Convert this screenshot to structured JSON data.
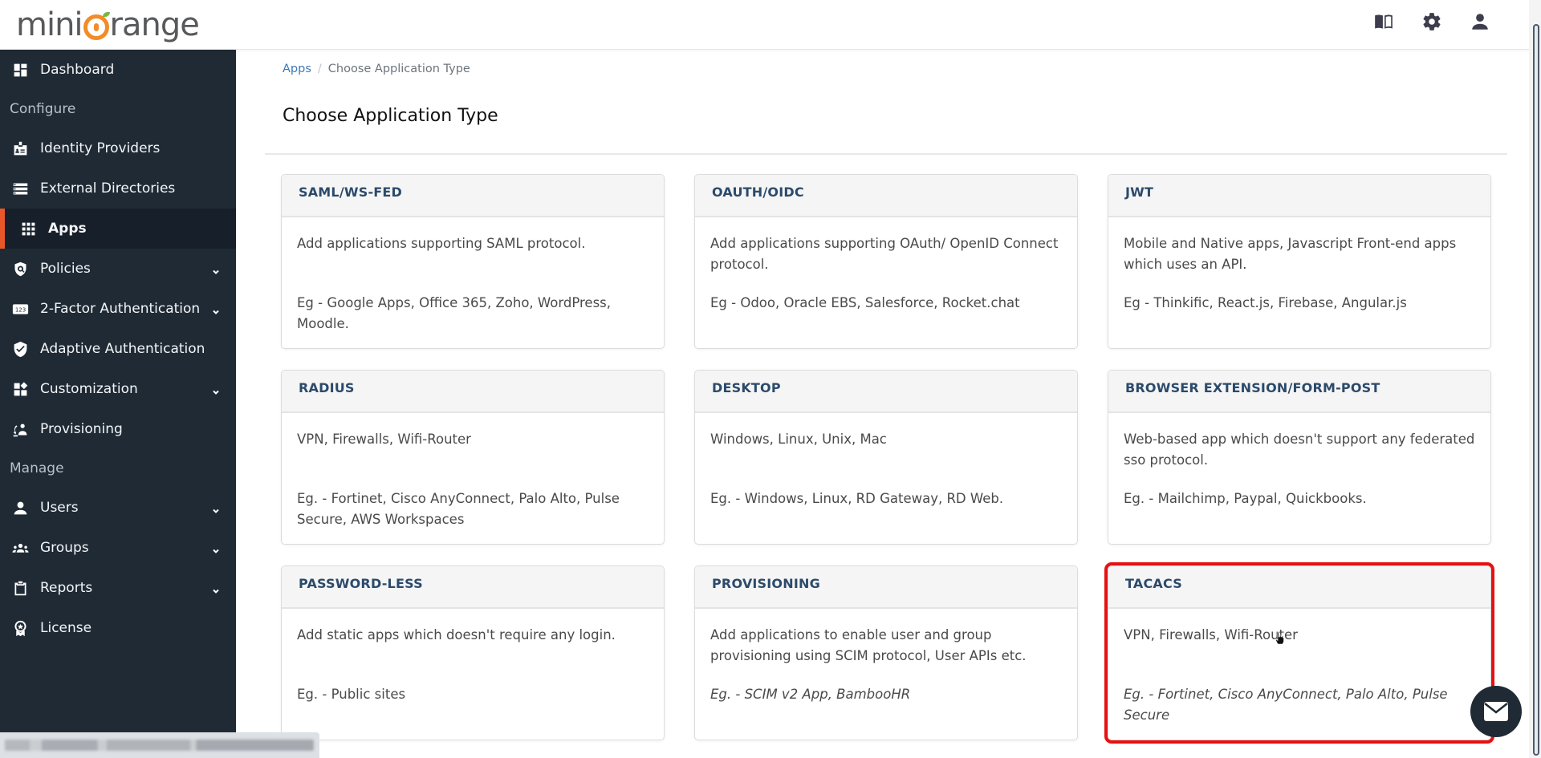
{
  "brand": {
    "name_before": "mini",
    "name_after": "range",
    "accent_orange": "#f28c28",
    "leaf_green": "#7ab648"
  },
  "topbar": {
    "icons": [
      {
        "name": "book-icon",
        "label": "Guides"
      },
      {
        "name": "gear-icon",
        "label": "Settings"
      },
      {
        "name": "user-icon",
        "label": "Account"
      }
    ]
  },
  "sidebar": {
    "items": [
      {
        "type": "item",
        "label": "Dashboard",
        "icon": "dashboard-icon"
      },
      {
        "type": "section",
        "label": "Configure"
      },
      {
        "type": "item",
        "label": "Identity Providers",
        "icon": "id-badge-icon"
      },
      {
        "type": "item",
        "label": "External Directories",
        "icon": "directory-list-icon"
      },
      {
        "type": "item",
        "label": "Apps",
        "icon": "apps-grid-icon",
        "active": true
      },
      {
        "type": "item",
        "label": "Policies",
        "icon": "policy-shield-icon",
        "expandable": true
      },
      {
        "type": "item",
        "label": "2-Factor Authentication",
        "icon": "123-icon",
        "expandable": true
      },
      {
        "type": "item",
        "label": "Adaptive Authentication",
        "icon": "shield-check-icon"
      },
      {
        "type": "item",
        "label": "Customization",
        "icon": "widgets-icon",
        "expandable": true
      },
      {
        "type": "item",
        "label": "Provisioning",
        "icon": "provisioning-icon"
      },
      {
        "type": "section",
        "label": "Manage"
      },
      {
        "type": "item",
        "label": "Users",
        "icon": "user-icon",
        "expandable": true
      },
      {
        "type": "item",
        "label": "Groups",
        "icon": "groups-icon",
        "expandable": true
      },
      {
        "type": "item",
        "label": "Reports",
        "icon": "clipboard-icon",
        "expandable": true
      },
      {
        "type": "item",
        "label": "License",
        "icon": "award-icon"
      }
    ],
    "active_accent": "#e8572a"
  },
  "breadcrumb": {
    "parent": "Apps",
    "separator": "/",
    "current": "Choose Application Type"
  },
  "page": {
    "title": "Choose Application Type"
  },
  "cards": [
    {
      "title": "SAML/WS-FED",
      "description": "Add applications supporting SAML protocol.",
      "examples": "Eg - Google Apps, Office 365, Zoho, WordPress, Moodle.",
      "italic": false
    },
    {
      "title": "OAUTH/OIDC",
      "description": "Add applications supporting OAuth/ OpenID Connect protocol.",
      "examples": "Eg - Odoo, Oracle EBS, Salesforce, Rocket.chat",
      "italic": false
    },
    {
      "title": "JWT",
      "description": "Mobile and Native apps, Javascript Front-end apps which uses an API.",
      "examples": "Eg - Thinkific, React.js, Firebase, Angular.js",
      "italic": false
    },
    {
      "title": "RADIUS",
      "description": "VPN, Firewalls, Wifi-Router",
      "examples": "Eg. - Fortinet, Cisco AnyConnect, Palo Alto, Pulse Secure, AWS Workspaces",
      "italic": false
    },
    {
      "title": "DESKTOP",
      "description": "Windows, Linux, Unix, Mac",
      "examples": "Eg. - Windows, Linux, RD Gateway, RD Web.",
      "italic": false
    },
    {
      "title": "BROWSER EXTENSION/FORM-POST",
      "description": "Web-based app which doesn't support any federated sso protocol.",
      "examples": "Eg. - Mailchimp, Paypal, Quickbooks.",
      "italic": false
    },
    {
      "title": "PASSWORD-LESS",
      "description": "Add static apps which doesn't require any login.",
      "examples": "Eg. - Public sites",
      "italic": false
    },
    {
      "title": "PROVISIONING",
      "description": "Add applications to enable user and group provisioning using SCIM protocol, User APIs etc.",
      "examples": "Eg. - SCIM v2 App, BambooHR",
      "italic": true
    },
    {
      "title": "TACACS",
      "description": "VPN, Firewalls, Wifi-Router",
      "examples": "Eg. - Fortinet, Cisco AnyConnect, Palo Alto, Pulse Secure",
      "italic": true,
      "highlighted": true
    }
  ],
  "highlight_color": "#e81010",
  "chat": {
    "icon": "mail-icon"
  }
}
